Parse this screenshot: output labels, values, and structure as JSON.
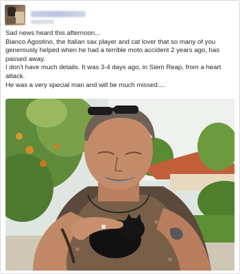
{
  "post": {
    "author_name": "",
    "lines": [
      "Sad news heard this afternoon...",
      "Bianco Agostino, the Italian sax player and cat lover that so many of you generously helped when he had a terrible moto accident 2 years ago, has passed away.",
      "I don't have much details. It was 3-4 days ago, in Siem Reap, from a heart attack.",
      "He was a very special man and will be much missed...."
    ]
  },
  "colors": {
    "text": "#1d2129",
    "card_border": "#d6d9de",
    "name_link": "#365899"
  }
}
